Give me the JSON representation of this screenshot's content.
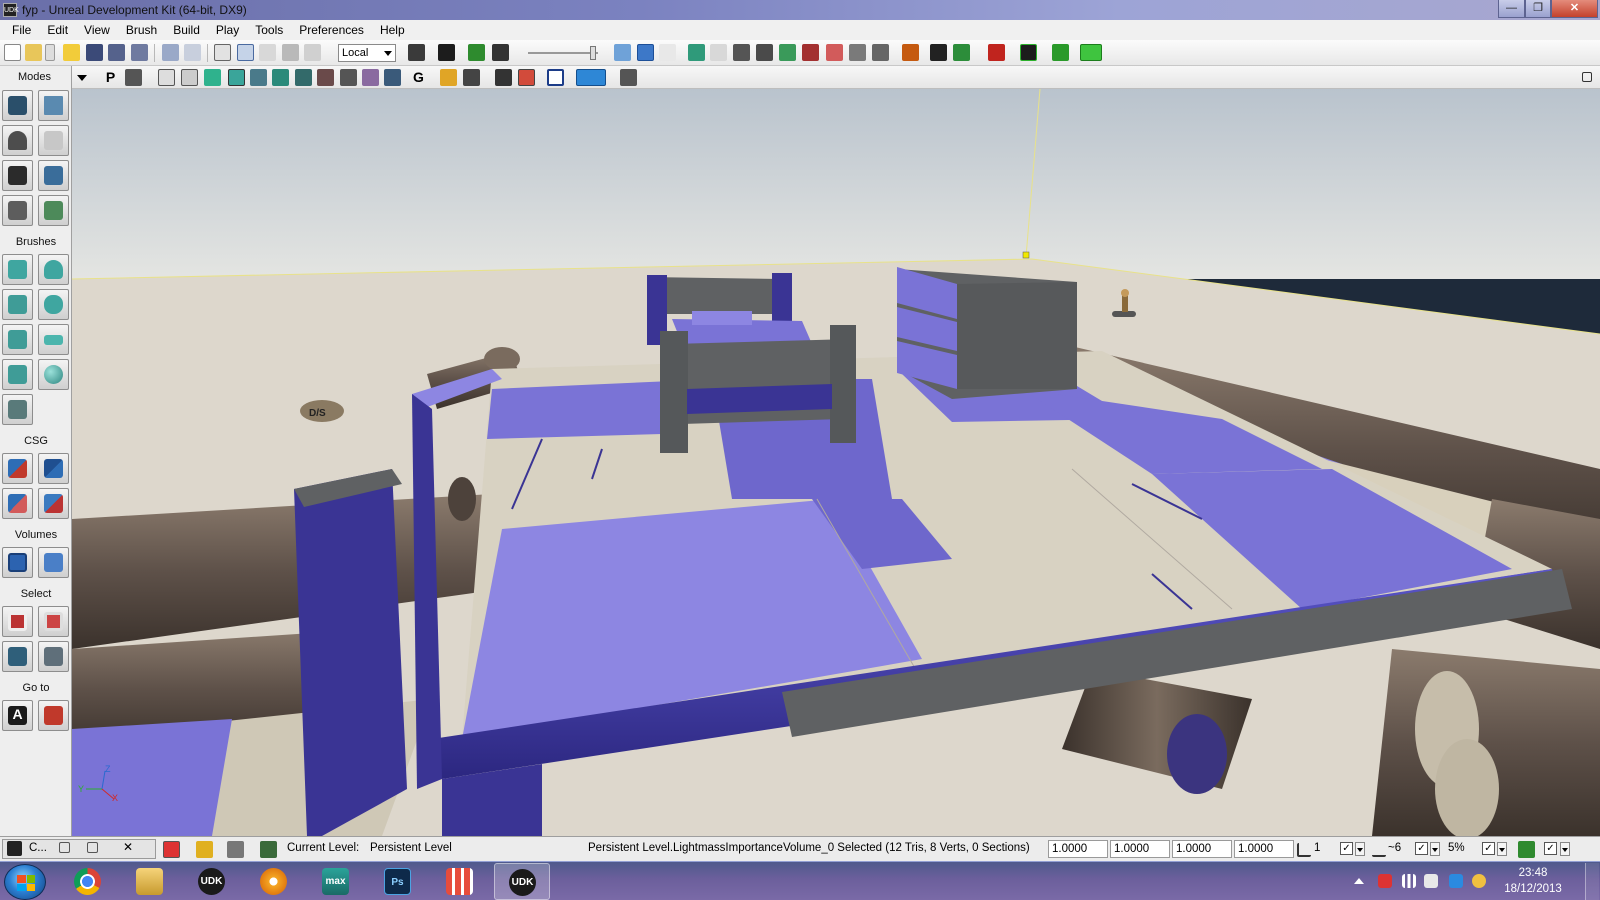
{
  "window": {
    "title": "fyp - Unreal Development Kit (64-bit, DX9)",
    "app_icon_text": "UDK",
    "min_label": "—",
    "max_label": "❐",
    "close_label": "✕"
  },
  "menu": [
    "File",
    "Edit",
    "View",
    "Brush",
    "Build",
    "Play",
    "Tools",
    "Preferences",
    "Help"
  ],
  "toolbar": {
    "coordinate_system": "Local",
    "toolbar2_labels": {
      "perspective": "P",
      "geometry": "G"
    }
  },
  "modes_panel": {
    "title": "Modes",
    "sections": {
      "brushes": "Brushes",
      "csg": "CSG",
      "volumes": "Volumes",
      "select": "Select",
      "goto": "Go to"
    },
    "goto_actor_label": "A"
  },
  "viewport": {
    "decal_label": "D/S",
    "axis": {
      "x": "X",
      "y": "Y",
      "z": "Z"
    },
    "colors": {
      "sky_top": "#c5ccd3",
      "sky_bottom": "#e6e6e3",
      "ground": "#d9d4ca",
      "purple": "#7a73d6",
      "purple_dark": "#3a3494",
      "cream": "#d8d2c2",
      "wood": "#5e5149",
      "gray": "#5f6163"
    }
  },
  "statusbar": {
    "tab_label": "C...",
    "current_level_label": "Current Level:",
    "current_level_value": "Persistent Level",
    "selection_info": "Persistent Level.LightmassImportanceVolume_0 Selected (12 Tris, 8 Verts, 0 Sections)",
    "drag_grid_values": [
      "1.0000",
      "1.0000",
      "1.0000",
      "1.0000"
    ],
    "grid_size": "1",
    "rotation_snap": "~6",
    "scale_snap": "5%",
    "check_mark": "✓"
  },
  "taskbar": {
    "time": "23:48",
    "date": "18/12/2013",
    "apps": [
      {
        "name": "chrome",
        "label": ""
      },
      {
        "name": "explorer",
        "label": ""
      },
      {
        "name": "udk",
        "label": "UDK"
      },
      {
        "name": "media",
        "label": ""
      },
      {
        "name": "3dsmax",
        "label": "max"
      },
      {
        "name": "photoshop",
        "label": "Ps"
      },
      {
        "name": "apps",
        "label": ""
      },
      {
        "name": "udk-active",
        "label": "UDK"
      }
    ]
  }
}
